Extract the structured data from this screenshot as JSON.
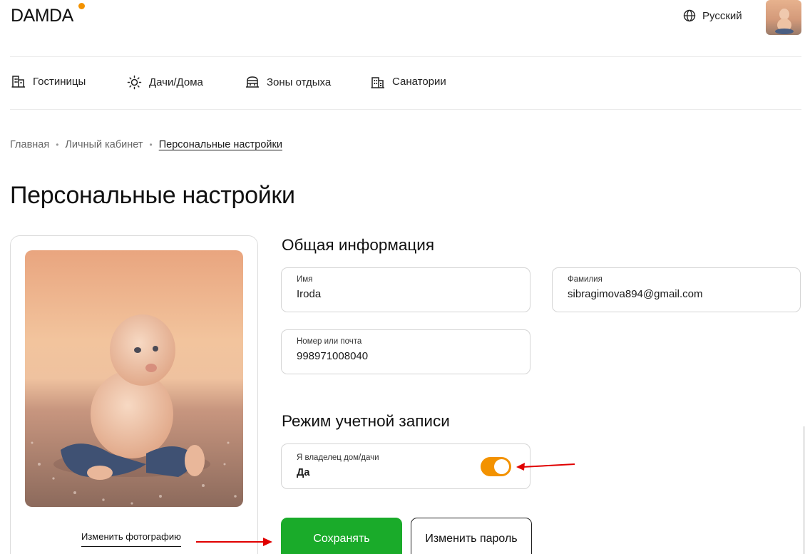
{
  "header": {
    "logo": "DAMDA",
    "language": "Русский",
    "colors": {
      "accent": "#f39200",
      "save": "#1aab2a",
      "annotation": "#e00000"
    }
  },
  "nav": {
    "items": [
      {
        "label": "Гостиницы",
        "icon": "hotel-icon"
      },
      {
        "label": "Дачи/Дома",
        "icon": "sun-icon"
      },
      {
        "label": "Зоны отдыха",
        "icon": "rest-zone-icon"
      },
      {
        "label": "Санатории",
        "icon": "sanatorium-icon"
      }
    ]
  },
  "breadcrumb": {
    "items": [
      "Главная",
      "Личный кабинет",
      "Персональные настройки"
    ],
    "separator": "•"
  },
  "page": {
    "title": "Персональные настройки"
  },
  "profile": {
    "change_photo": "Изменить фотографию"
  },
  "general": {
    "title": "Общая информация",
    "name_label": "Имя",
    "name_value": "Iroda",
    "surname_label": "Фамилия",
    "surname_value": "sibragimova894@gmail.com",
    "contact_label": "Номер или почта",
    "contact_value": "998971008040"
  },
  "account_mode": {
    "title": "Режим учетной записи",
    "owner_label": "Я владелец дом/дачи",
    "owner_value": "Да",
    "owner_toggle_on": true
  },
  "actions": {
    "save": "Сохранять",
    "change_password": "Изменить пароль"
  }
}
